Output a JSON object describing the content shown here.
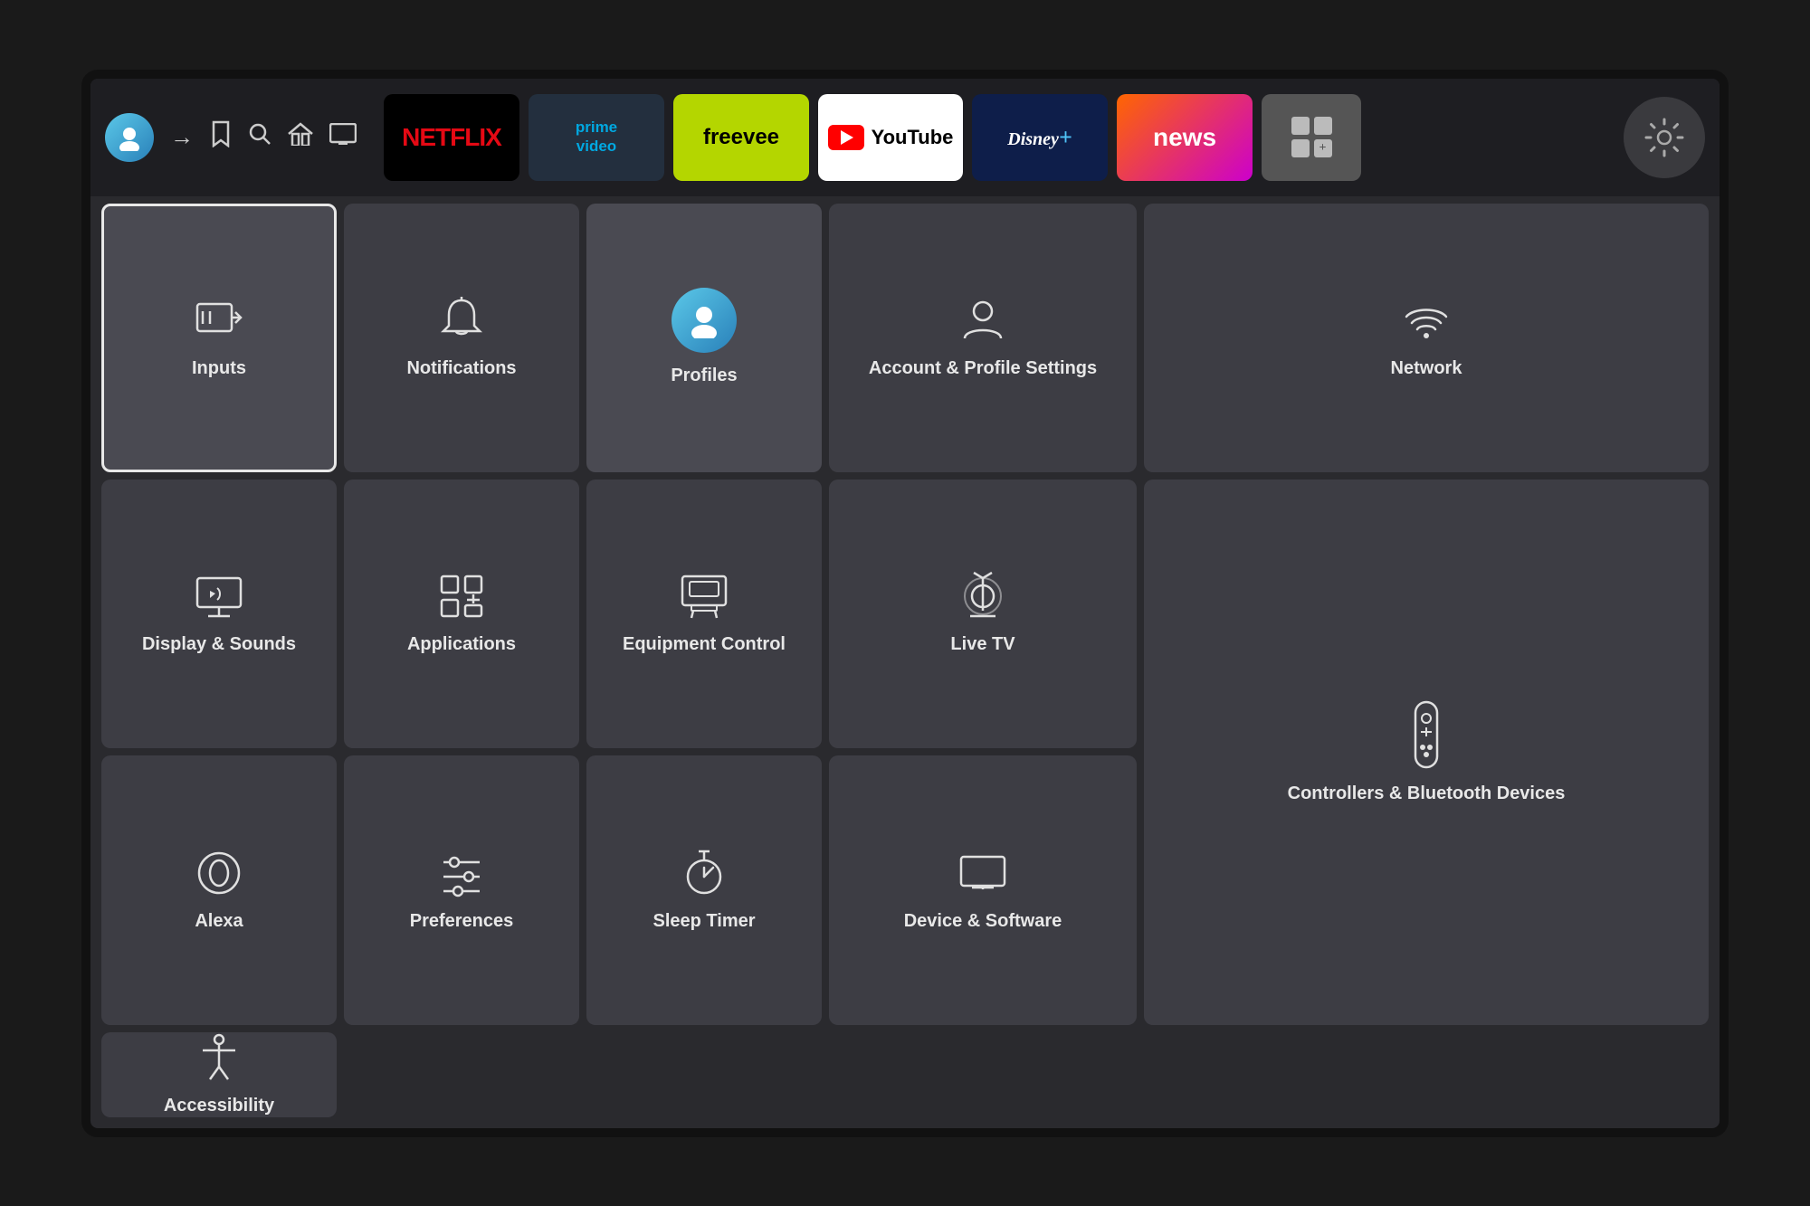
{
  "topNav": {
    "apps": [
      {
        "id": "netflix",
        "label": "NETFLIX"
      },
      {
        "id": "prime",
        "label": "prime\nvideo"
      },
      {
        "id": "freevee",
        "label": "freevee"
      },
      {
        "id": "youtube",
        "label": "YouTube"
      },
      {
        "id": "disney",
        "label": "Disney+"
      },
      {
        "id": "news",
        "label": "news"
      },
      {
        "id": "more",
        "label": "OO\nO+"
      }
    ]
  },
  "grid": {
    "items": [
      {
        "id": "inputs",
        "label": "Inputs",
        "icon": "input",
        "selected": true
      },
      {
        "id": "notifications",
        "label": "Notifications",
        "icon": "bell"
      },
      {
        "id": "profiles",
        "label": "Profiles",
        "icon": "profile-avatar"
      },
      {
        "id": "account-profile-settings",
        "label": "Account & Profile Settings",
        "icon": "person"
      },
      {
        "id": "network",
        "label": "Network",
        "icon": "wifi"
      },
      {
        "id": "display-sounds",
        "label": "Display & Sounds",
        "icon": "display"
      },
      {
        "id": "applications",
        "label": "Applications",
        "icon": "apps"
      },
      {
        "id": "equipment-control",
        "label": "Equipment Control",
        "icon": "monitor"
      },
      {
        "id": "live-tv",
        "label": "Live TV",
        "icon": "antenna"
      },
      {
        "id": "controllers-bluetooth",
        "label": "Controllers & Bluetooth Devices",
        "icon": "remote"
      },
      {
        "id": "alexa",
        "label": "Alexa",
        "icon": "alexa"
      },
      {
        "id": "preferences",
        "label": "Preferences",
        "icon": "sliders"
      },
      {
        "id": "sleep-timer",
        "label": "Sleep Timer",
        "icon": "timer"
      },
      {
        "id": "device-software",
        "label": "Device & Software",
        "icon": "tv"
      },
      {
        "id": "accessibility",
        "label": "Accessibility",
        "icon": "accessibility"
      }
    ]
  }
}
